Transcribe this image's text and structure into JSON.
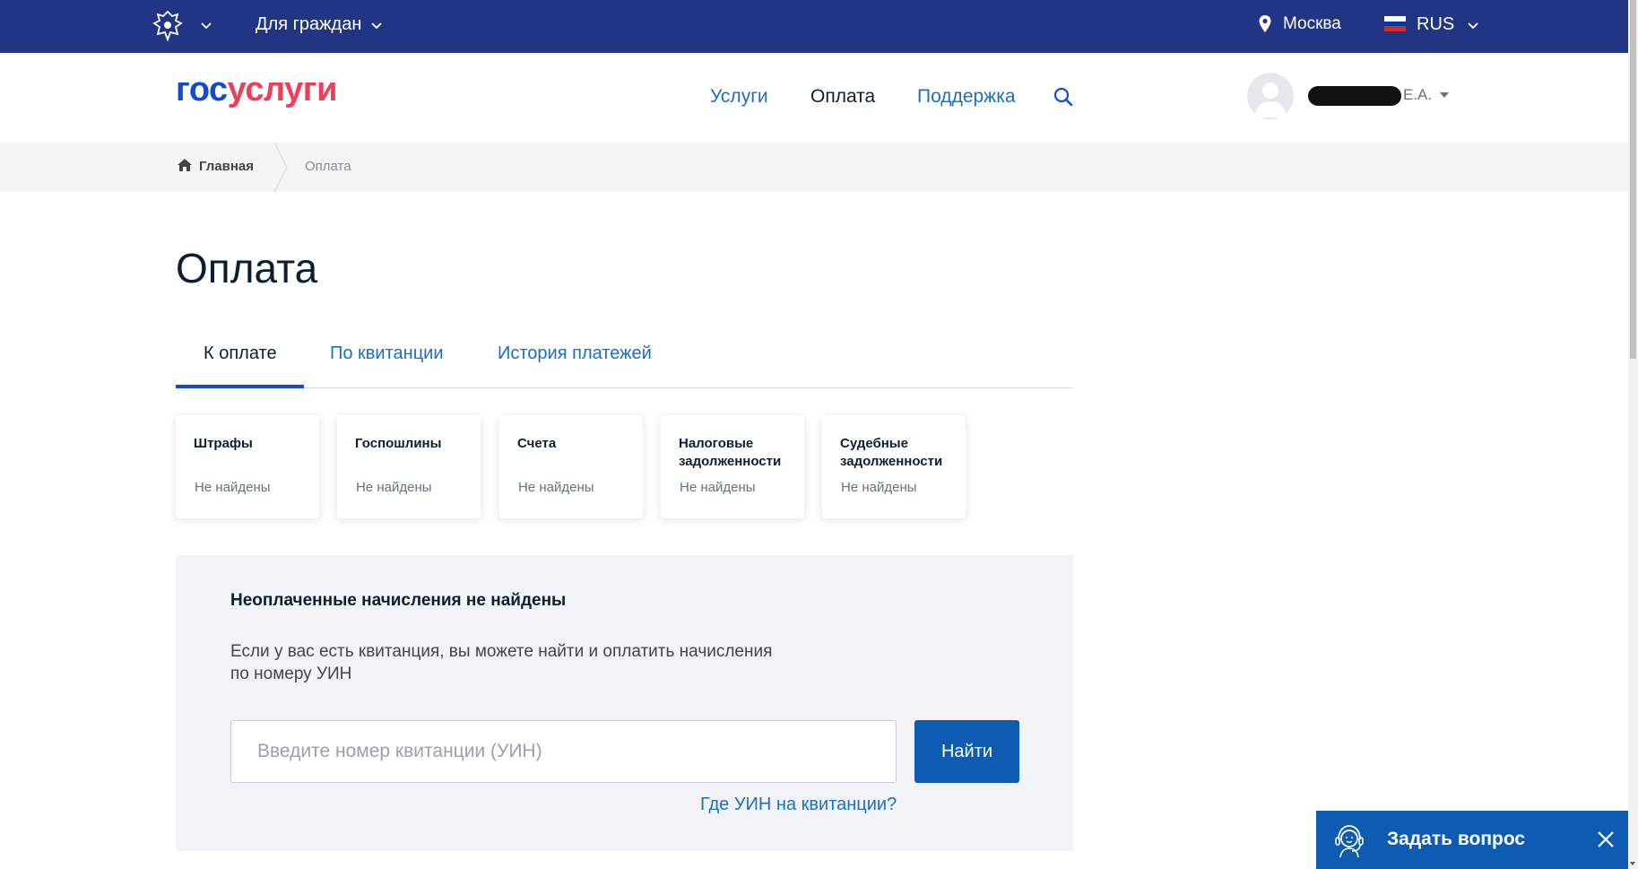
{
  "colors": {
    "topbar": "#213584",
    "accent": "#0d4cd3",
    "link": "#1a6fc2",
    "brand_red": "#ee3f58",
    "button": "#0d5cb2"
  },
  "topbar": {
    "section_label": "Для граждан",
    "city": "Москва",
    "language": "RUS",
    "icons": {
      "emblem": "coat-of-arms-icon",
      "location": "map-pin-icon",
      "flag": "russia-flag-icon"
    }
  },
  "header": {
    "logo": {
      "part1": "гос",
      "part2": "услуги"
    },
    "nav": [
      {
        "label": "Услуги",
        "active": false
      },
      {
        "label": "Оплата",
        "active": true
      },
      {
        "label": "Поддержка",
        "active": false
      }
    ],
    "user": {
      "initials": "Е.А."
    }
  },
  "breadcrumb": {
    "home": "Главная",
    "current": "Оплата"
  },
  "page": {
    "title": "Оплата"
  },
  "tabs": [
    {
      "label": "К оплате",
      "active": true
    },
    {
      "label": "По квитанции",
      "active": false
    },
    {
      "label": "История платежей",
      "active": false
    }
  ],
  "cards": [
    {
      "title": "Штрафы",
      "status": "Не найдены"
    },
    {
      "title": "Госпошлины",
      "status": "Не найдены"
    },
    {
      "title": "Счета",
      "status": "Не найдены"
    },
    {
      "title": "Налоговые задолженности",
      "status": "Не найдены"
    },
    {
      "title": "Судебные задолженности",
      "status": "Не найдены"
    }
  ],
  "panel": {
    "title": "Неоплаченные начисления не найдены",
    "text_line1": "Если у вас есть квитанция, вы можете найти и оплатить начисления",
    "text_line2": "по номеру УИН",
    "input_placeholder": "Введите номер квитанции (УИН)",
    "input_value": "",
    "button_label": "Найти",
    "help_link": "Где УИН на квитанции?"
  },
  "chat": {
    "label": "Задать вопрос"
  }
}
